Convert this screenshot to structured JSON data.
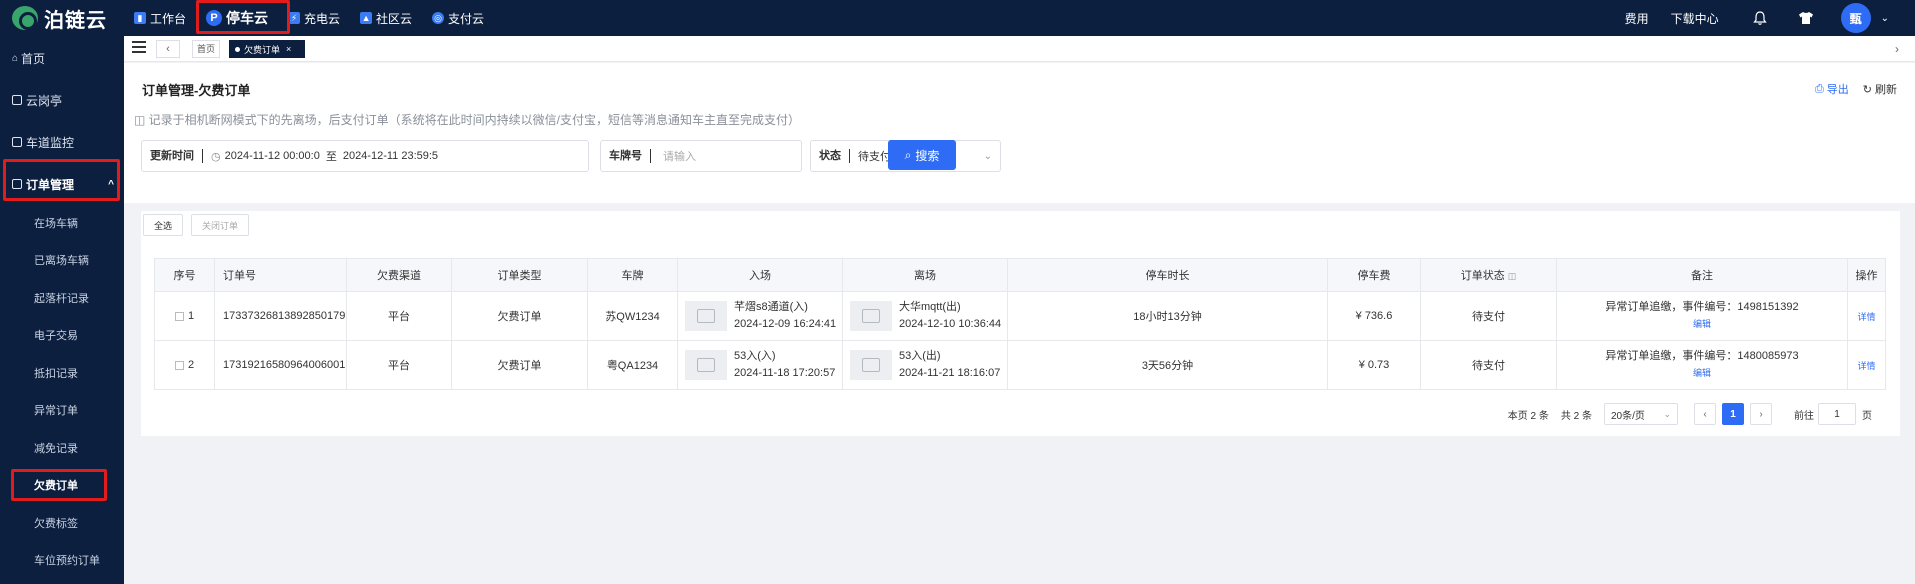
{
  "brand": {
    "name": "泊链云"
  },
  "topnav": {
    "items": [
      {
        "label": "工作台",
        "icon": "dashboard-icon"
      },
      {
        "label": "停车云",
        "icon": "parking-icon"
      },
      {
        "label": "充电云",
        "icon": "charging-icon"
      },
      {
        "label": "社区云",
        "icon": "community-icon"
      },
      {
        "label": "支付云",
        "icon": "payment-icon"
      }
    ],
    "active": "停车云",
    "right": {
      "fees": "费用",
      "download": "下载中心",
      "avatar_text": "甄"
    }
  },
  "sidebar": {
    "items": [
      {
        "label": "首页"
      },
      {
        "label": "云岗亭"
      },
      {
        "label": "车道监控"
      },
      {
        "label": "订单管理"
      }
    ],
    "sub_items": [
      {
        "label": "在场车辆"
      },
      {
        "label": "已离场车辆"
      },
      {
        "label": "起落杆记录"
      },
      {
        "label": "电子交易"
      },
      {
        "label": "抵扣记录"
      },
      {
        "label": "异常订单"
      },
      {
        "label": "减免记录"
      },
      {
        "label": "欠费订单"
      },
      {
        "label": "欠费标签"
      },
      {
        "label": "车位预约订单"
      }
    ],
    "active_sub": "欠费订单",
    "parent_chevron": "^"
  },
  "tabs": {
    "home": "首页",
    "active": "欠费订单",
    "close": "×"
  },
  "page": {
    "title": "订单管理-欠费订单",
    "description": "记录于相机断网模式下的先离场，后支付订单（系统将在此时间内持续以微信/支付宝，短信等消息通知车主直至完成支付）",
    "export": "导出",
    "refresh": "刷新"
  },
  "filters": {
    "update_time": {
      "label": "更新时间",
      "start": "2024-11-12 00:00:0",
      "sep": "至",
      "end": "2024-12-11 23:59:5"
    },
    "plate": {
      "label": "车牌号",
      "placeholder": "请输入"
    },
    "status": {
      "label": "状态",
      "value": "待支付"
    },
    "search_button": "搜索"
  },
  "chips": {
    "select_all": "全选",
    "close_order": "关闭订单"
  },
  "table": {
    "columns": [
      "序号",
      "订单号",
      "欠费渠道",
      "订单类型",
      "车牌",
      "入场",
      "离场",
      "停车时长",
      "停车费",
      "订单状态",
      "备注",
      "操作"
    ],
    "rows": [
      {
        "index": "1",
        "order_no": "17337326813892850179",
        "channel": "平台",
        "type": "欠费订单",
        "plate": "苏QW1234",
        "entry_gate": "芊熠s8通道(入)",
        "entry_time": "2024-12-09 16:24:41",
        "exit_gate": "大华mqtt(出)",
        "exit_time": "2024-12-10 10:36:44",
        "duration": "18小时13分钟",
        "fee": "¥ 736.6",
        "status": "待支付",
        "remark": "异常订单追缴，事件编号：1498151392",
        "remark_edit": "编辑",
        "action": "详情"
      },
      {
        "index": "2",
        "order_no": "17319216580964006001",
        "channel": "平台",
        "type": "欠费订单",
        "plate": "粤QA1234",
        "entry_gate": "53入(入)",
        "entry_time": "2024-11-18 17:20:57",
        "exit_gate": "53入(出)",
        "exit_time": "2024-11-21 18:16:07",
        "duration": "3天56分钟",
        "fee": "¥ 0.73",
        "status": "待支付",
        "remark": "异常订单追缴，事件编号：1480085973",
        "remark_edit": "编辑",
        "action": "详情"
      }
    ]
  },
  "pagination": {
    "page_count_text": "本页 2 条",
    "total_text": "共 2 条",
    "page_size": "20条/页",
    "current_page": "1",
    "goto_label": "前往",
    "goto_value": "1",
    "goto_suffix": "页"
  },
  "colors": {
    "nav_bg": "#0c1f3f",
    "accent": "#2f6cf5",
    "pending": "#e6a23c",
    "highlight": "#e21b1b"
  }
}
